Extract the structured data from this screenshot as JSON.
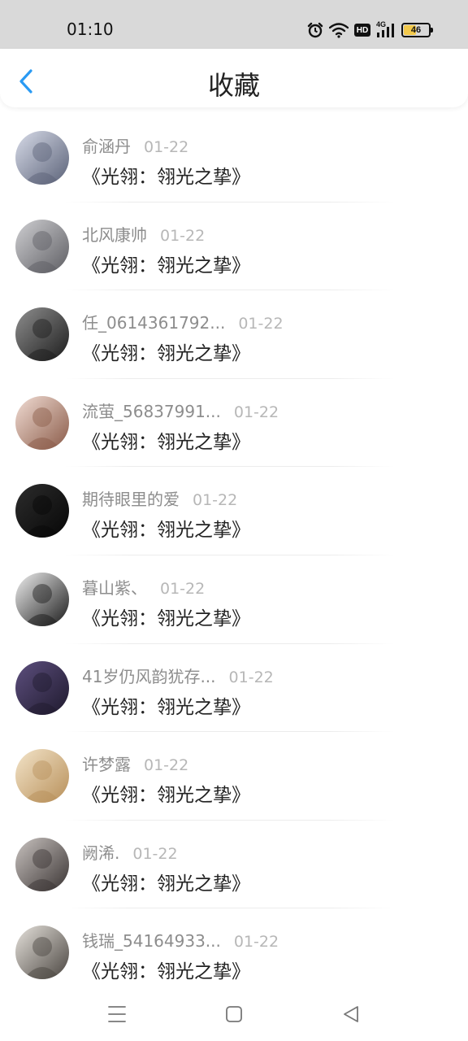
{
  "status_bar": {
    "time": "01:10",
    "battery_level": "46",
    "hd_badge": "HD",
    "network_label": "4G",
    "icons": [
      "alarm-icon",
      "wifi-icon",
      "hd-icon",
      "signal-4g-icon",
      "battery-icon"
    ]
  },
  "header": {
    "title": "收藏",
    "back_icon": "chevron-left-icon",
    "accent_color": "#2a9af3"
  },
  "favorites": [
    {
      "user": "俞涵丹",
      "date": "01-22",
      "title": "《光翎：翎光之挚》",
      "avatar_colors": [
        "#d7dbe8",
        "#5b6278"
      ]
    },
    {
      "user": "北风康帅",
      "date": "01-22",
      "title": "《光翎：翎光之挚》",
      "avatar_colors": [
        "#cfcfd2",
        "#5e5e63"
      ]
    },
    {
      "user": "任_0614361792...",
      "date": "01-22",
      "title": "《光翎：翎光之挚》",
      "avatar_colors": [
        "#8f8f8f",
        "#1c1c1c"
      ]
    },
    {
      "user": "流萤_56837991...",
      "date": "01-22",
      "title": "《光翎：翎光之挚》",
      "avatar_colors": [
        "#f1ddd4",
        "#8a5a48"
      ]
    },
    {
      "user": "期待眼里的爱",
      "date": "01-22",
      "title": "《光翎：翎光之挚》",
      "avatar_colors": [
        "#2c2c2c",
        "#070707"
      ]
    },
    {
      "user": "暮山紫、",
      "date": "01-22",
      "title": "《光翎：翎光之挚》",
      "avatar_colors": [
        "#f0f0f0",
        "#1a1a1a"
      ]
    },
    {
      "user": "41岁仍风韵犹存...",
      "date": "01-22",
      "title": "《光翎：翎光之挚》",
      "avatar_colors": [
        "#5d4f7e",
        "#1f1a2e"
      ]
    },
    {
      "user": "许梦露",
      "date": "01-22",
      "title": "《光翎：翎光之挚》",
      "avatar_colors": [
        "#f3e4c9",
        "#b8905a"
      ]
    },
    {
      "user": "阙浠.",
      "date": "01-22",
      "title": "《光翎：翎光之挚》",
      "avatar_colors": [
        "#c9c3c0",
        "#3a3433"
      ]
    },
    {
      "user": "钱瑞_54164933...",
      "date": "01-22",
      "title": "《光翎：翎光之挚》",
      "avatar_colors": [
        "#e6e2dc",
        "#4a4540"
      ]
    }
  ],
  "nav_bar": {
    "icons": [
      "menu-icon",
      "home-square-icon",
      "back-triangle-icon"
    ]
  }
}
